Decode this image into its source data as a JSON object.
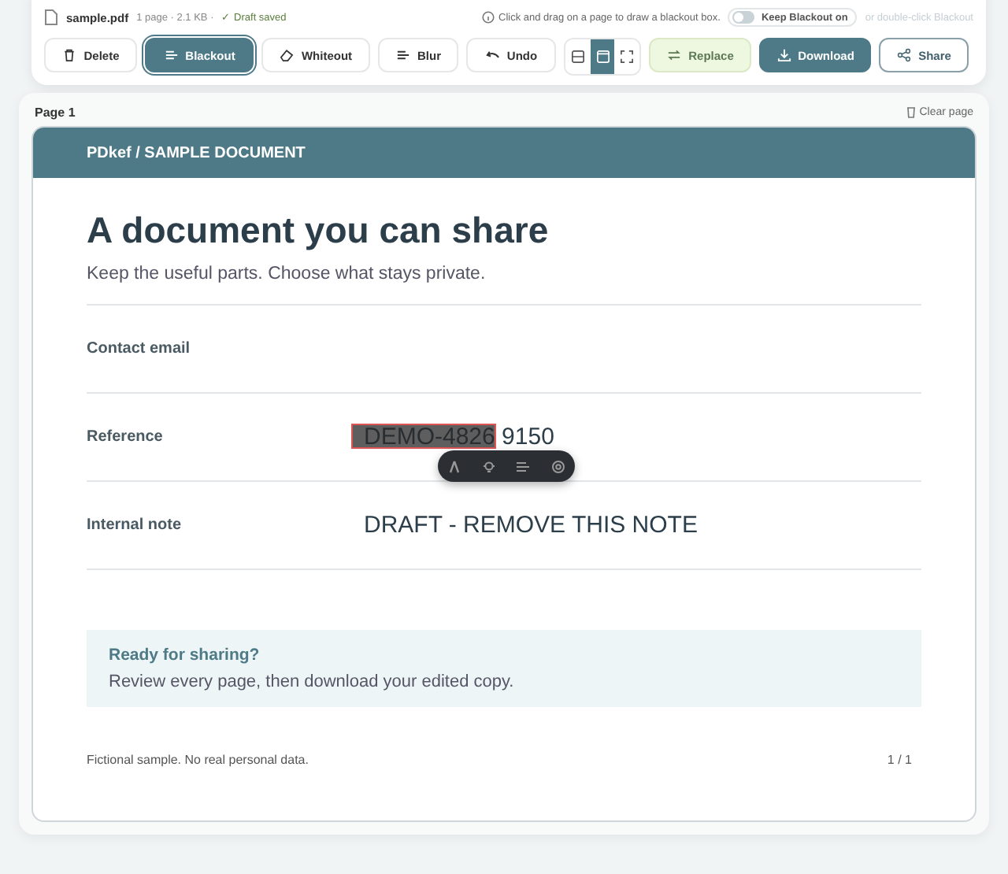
{
  "file": {
    "name": "sample.pdf",
    "meta": "1 page · 2.1 KB ·",
    "status": "✓ Draft saved"
  },
  "hint": "Click and drag on a page to draw a blackout box.",
  "keep_toggle": {
    "label": "Keep Blackout on",
    "on": false
  },
  "toggle_note": "or double-click Blackout",
  "tools": [
    {
      "label": "Delete",
      "selected": false
    },
    {
      "label": "Blackout",
      "selected": true
    },
    {
      "label": "Whiteout",
      "selected": false
    },
    {
      "label": "Blur",
      "selected": false
    },
    {
      "label": "Undo",
      "selected": false
    }
  ],
  "view_modes": [
    {
      "selected": false
    },
    {
      "selected": true
    },
    {
      "selected": false
    }
  ],
  "actions": [
    {
      "label": "Replace",
      "kind": "soft"
    },
    {
      "label": "Download",
      "kind": "primary"
    },
    {
      "label": "Share",
      "kind": "outline"
    }
  ],
  "page": {
    "label": "Page 1",
    "clear": "Clear page"
  },
  "document": {
    "header": "PDkef / SAMPLE DOCUMENT",
    "title": "A document you can share",
    "subtitle": "Keep the useful parts. Choose what stays private.",
    "fields": [
      {
        "label": "Contact email"
      },
      {
        "label": "Reference",
        "value": [
          {
            "text": "DEMO-4826",
            "redacted": true
          },
          {
            "text": "9150",
            "redacted": false
          }
        ]
      },
      {
        "label": "Internal note",
        "value": [
          {
            "text": "DRAFT - REMOVE THIS NOTE",
            "redacted": false
          }
        ]
      }
    ],
    "callout": {
      "title": "Ready for sharing?",
      "text": "Review every page, then download your edited copy."
    },
    "footer": "Fictional sample. No real personal data.",
    "page_count": "1 / 1"
  }
}
